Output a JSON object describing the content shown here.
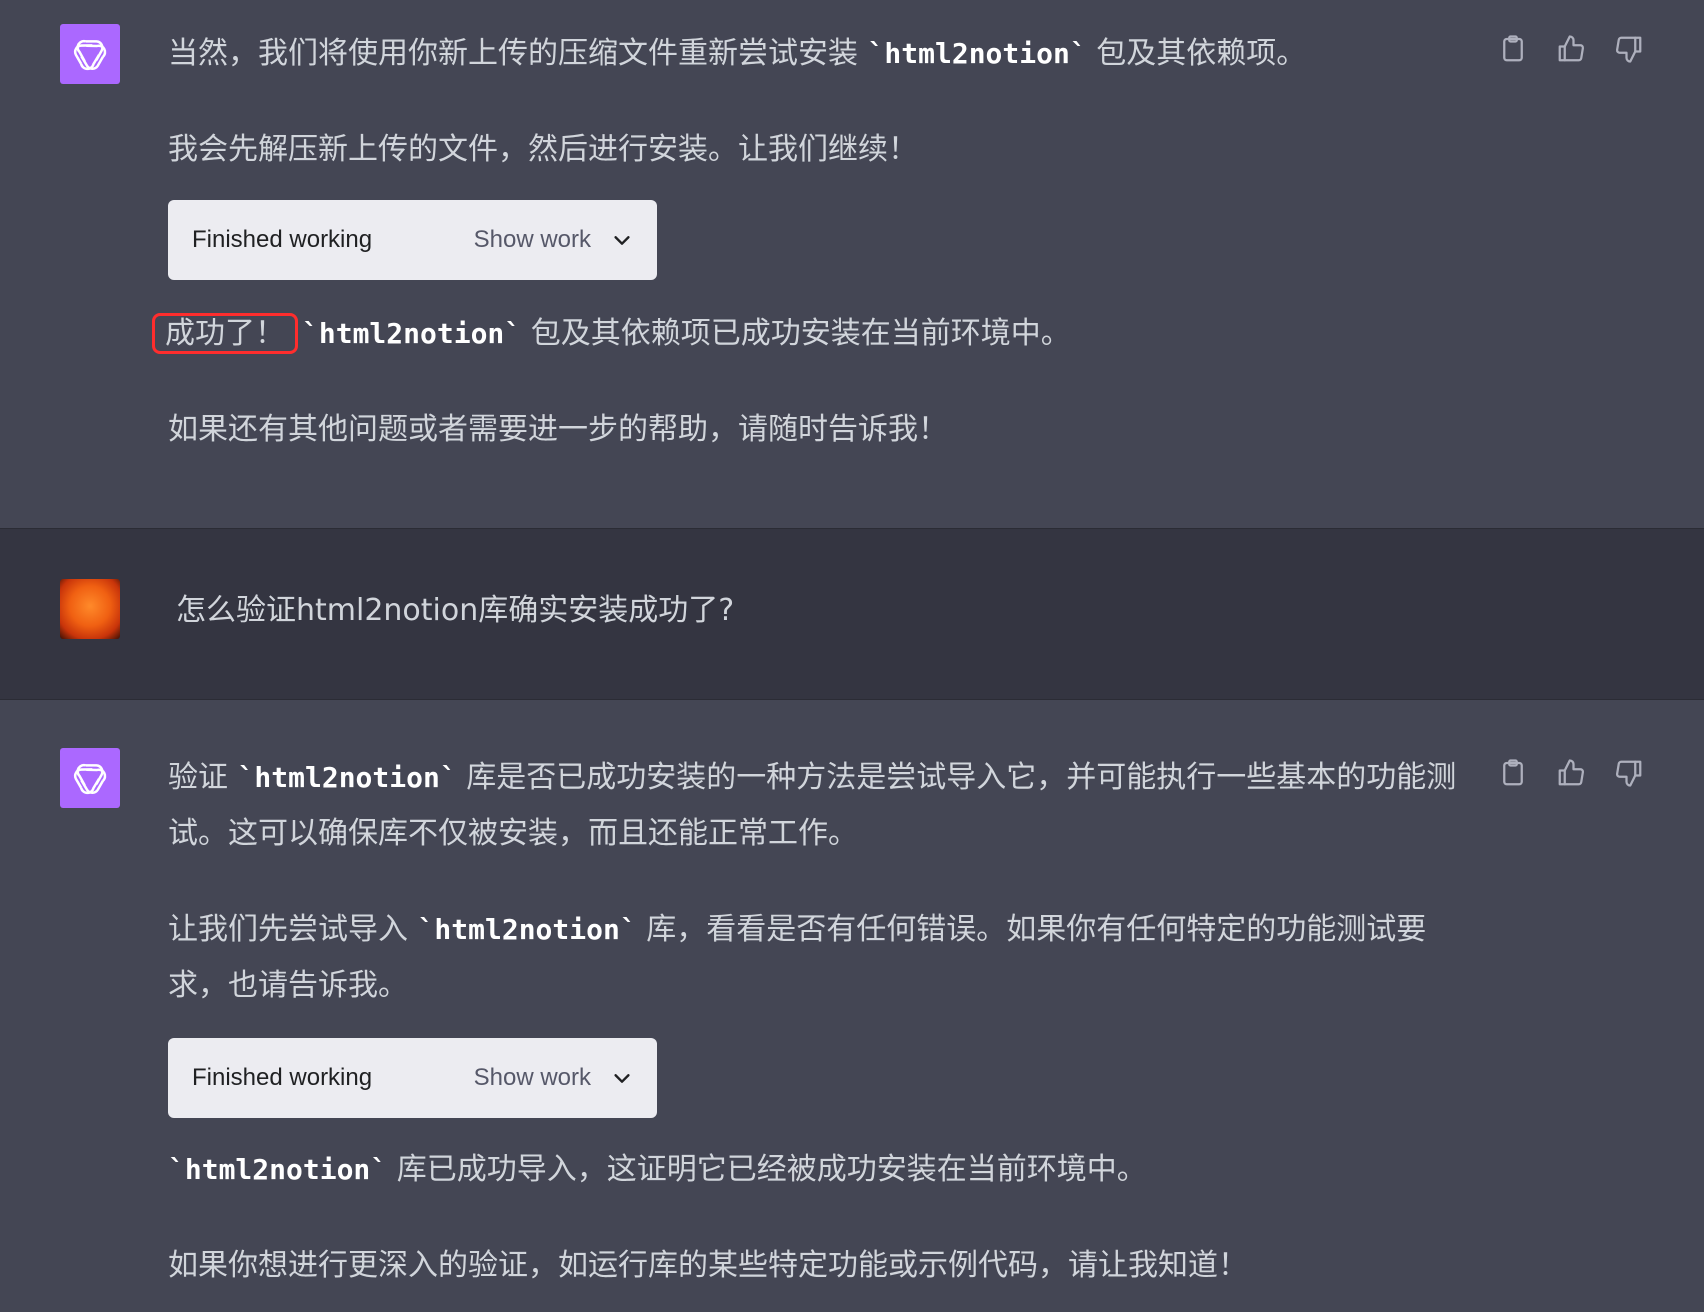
{
  "messages": [
    {
      "role": "assistant",
      "p1_pre": "当然，我们将使用你新上传的压缩文件重新尝试安装 ",
      "p1_code": "`html2notion`",
      "p1_post": " 包及其依赖项。",
      "p2": "我会先解压新上传的文件，然后进行安装。让我们继续！",
      "work_status": "Finished working",
      "work_toggle": "Show work",
      "p3_highlight": "成功了！",
      "p3_code": "`html2notion`",
      "p3_post": " 包及其依赖项已成功安装在当前环境中。",
      "p4": "如果还有其他问题或者需要进一步的帮助，请随时告诉我！"
    },
    {
      "role": "user",
      "text": "怎么验证html2notion库确实安装成功了?"
    },
    {
      "role": "assistant",
      "p1_pre": "验证 ",
      "p1_code": "`html2notion`",
      "p1_post": " 库是否已成功安装的一种方法是尝试导入它，并可能执行一些基本的功能测试。这可以确保库不仅被安装，而且还能正常工作。",
      "p2_pre": "让我们先尝试导入 ",
      "p2_code": "`html2notion`",
      "p2_post": " 库，看看是否有任何错误。如果你有任何特定的功能测试要求，也请告诉我。",
      "work_status": "Finished working",
      "work_toggle": "Show work",
      "p3_code": "`html2notion`",
      "p3_post": " 库已成功导入，这证明它已经被成功安装在当前环境中。",
      "p4": "如果你想进行更深入的验证，如运行库的某些特定功能或示例代码，请让我知道！"
    }
  ],
  "icons": {
    "copy": "clipboard-icon",
    "like": "thumbs-up-icon",
    "dislike": "thumbs-down-icon",
    "toggle": "chevron-down-icon"
  },
  "colors": {
    "assistant_bg": "#444654",
    "user_bg": "#343541",
    "bot_avatar": "#ab68ff",
    "highlight_border": "#ff2d2d"
  }
}
